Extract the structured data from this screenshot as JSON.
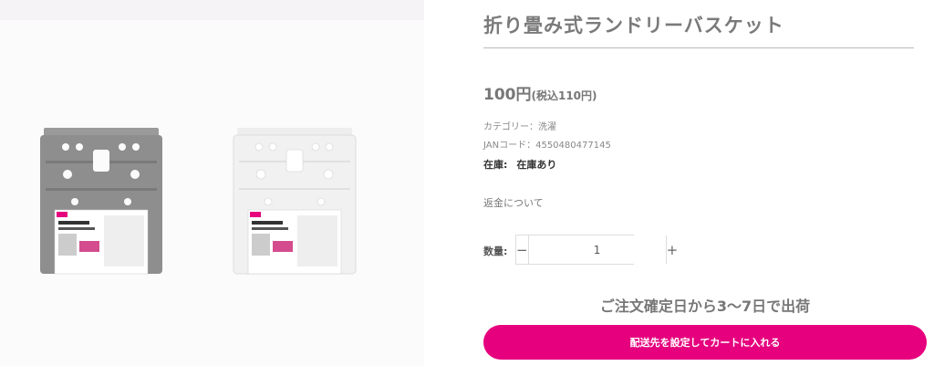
{
  "product": {
    "title": "折り畳み式ランドリーバスケット",
    "price_main": "100円",
    "price_tax": "(税込110円)",
    "category": "カテゴリー：洗濯",
    "jan": "JANコード：4550480477145",
    "stock_label": "在庫:",
    "stock_value": "在庫あり",
    "refund_link": "返金について"
  },
  "quantity": {
    "label": "数量:",
    "value": "1",
    "minus": "−",
    "plus": "+"
  },
  "shipping_note": "ご注文確定日から3〜7日で出荷",
  "cart_button_label": "配送先を設定してカートに入れる",
  "images": [
    {
      "variant": "gray",
      "color": "#8f8f8f"
    },
    {
      "variant": "white",
      "color": "#f2f2f2"
    }
  ],
  "colors": {
    "accent": "#e6007e",
    "title_gray": "#7a7a7a"
  }
}
